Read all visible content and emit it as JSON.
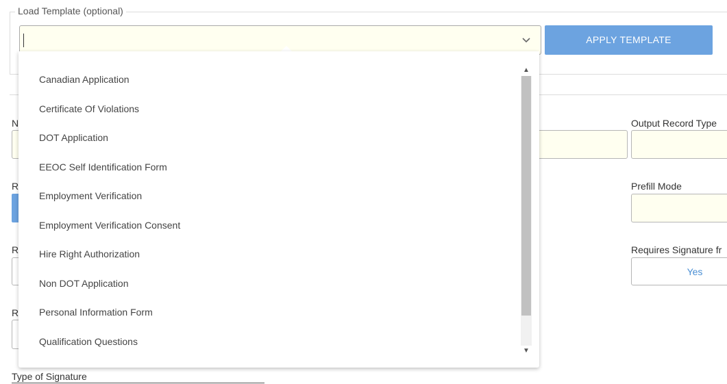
{
  "template_section": {
    "legend": "Load Template (optional)",
    "select_value": "",
    "apply_label": "APPLY TEMPLATE"
  },
  "form": {
    "name_label_fragment": "N",
    "output_record_type_label": "Output Record Type",
    "r1_label_fragment": "R",
    "prefill_mode_label": "Prefill Mode",
    "r2_label_fragment": "R",
    "requires_signature_label": "Requires Signature fr",
    "requires_signature_value": "Yes",
    "r3_label_fragment": "R",
    "type_of_signature_label": "Type of Signature"
  },
  "dropdown": {
    "options": [
      "Canadian Application",
      "Certificate Of Violations",
      "DOT Application",
      "EEOC Self Identification Form",
      "Employment Verification",
      "Employment Verification Consent",
      "Hire Right Authorization",
      "Non DOT Application",
      "Personal Information Form",
      "Qualification Questions"
    ]
  },
  "colors": {
    "accent": "#6ca3e0",
    "input_bg": "#fffff0"
  }
}
